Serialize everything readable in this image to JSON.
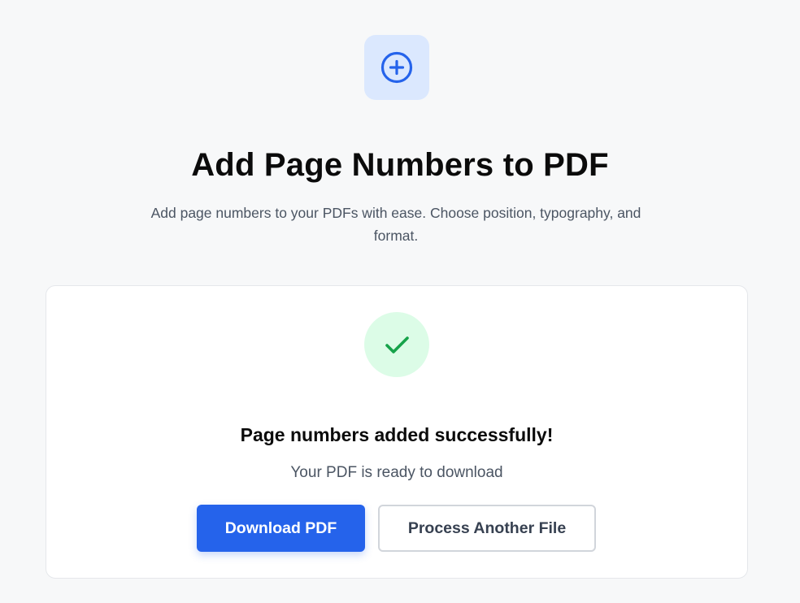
{
  "header": {
    "icon": "plus-circle-icon",
    "title": "Add Page Numbers to PDF",
    "subtitle": "Add page numbers to your PDFs with ease. Choose position, typography, and format."
  },
  "result": {
    "icon": "check-icon",
    "title": "Page numbers added successfully!",
    "subtitle": "Your PDF is ready to download",
    "download_label": "Download PDF",
    "process_another_label": "Process Another File"
  },
  "colors": {
    "accent": "#2563eb",
    "accent_light": "#dbe8fe",
    "success": "#16a34a",
    "success_light": "#dcfce7",
    "background": "#f7f8f9"
  }
}
